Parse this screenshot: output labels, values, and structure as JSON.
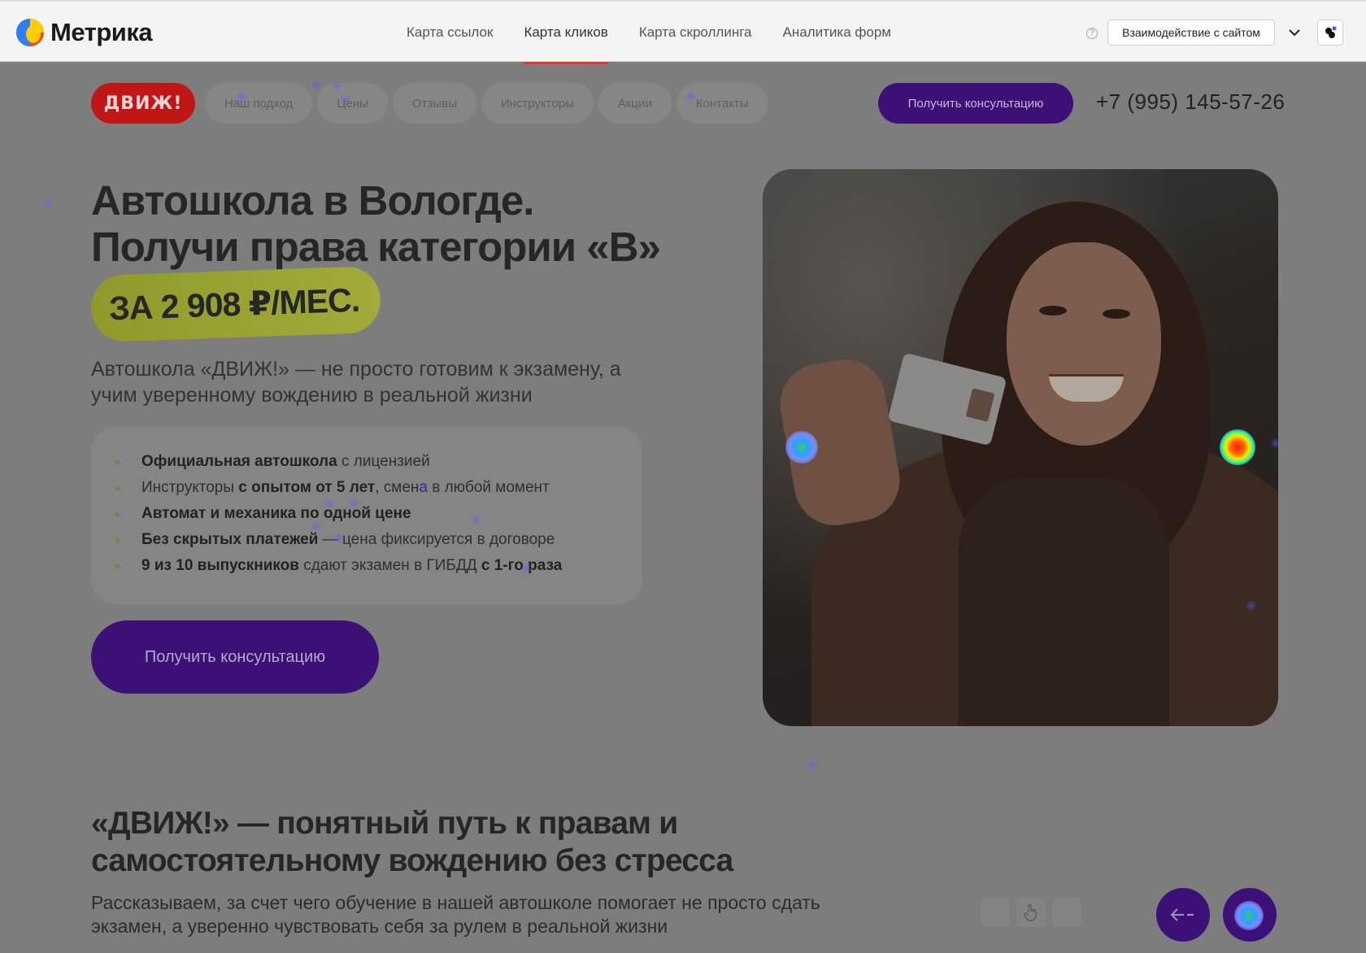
{
  "metrika": {
    "logo_text": "Метрика",
    "tabs": [
      {
        "label": "Карта ссылок",
        "active": false
      },
      {
        "label": "Карта кликов",
        "active": true
      },
      {
        "label": "Карта скроллинга",
        "active": false
      },
      {
        "label": "Аналитика форм",
        "active": false
      }
    ],
    "help_glyph": "?",
    "mode_select": "Взаимодействие с сайтом"
  },
  "site": {
    "logo_text": "ДВИЖ!",
    "nav": [
      "Наш подход",
      "Цены",
      "Отзывы",
      "Инструкторы",
      "Акции",
      "Контакты"
    ],
    "cta_top": "Получить консультацию",
    "phone": "+7 (995) 145-57-26"
  },
  "hero": {
    "title_line1": "Автошкола в Вологде.",
    "title_line2": "Получи права категории «В»",
    "price_badge": "ЗА 2 908 ₽/МЕС.",
    "subtitle": "Автошкола «ДВИЖ!» — не просто готовим к экзамену, а учим уверенному вождению в реальной жизни",
    "features": [
      {
        "bold1": "Официальная автошкола",
        "text1": " с лицензией",
        "bold2": "",
        "text2": ""
      },
      {
        "bold1": "",
        "text1": "Инструкторы ",
        "bold2": "с опытом от 5 лет",
        "text2": ", смена в любой момент"
      },
      {
        "bold1": "Автомат и механика по одной цене",
        "text1": "",
        "bold2": "",
        "text2": ""
      },
      {
        "bold1": "Без скрытых платежей",
        "text1": " — цена фиксируется в договоре",
        "bold2": "",
        "text2": ""
      },
      {
        "bold1": "9 из 10 выпускников",
        "text1": " сдают экзамен в ГИБДД ",
        "bold2": "с 1-го раза",
        "text2": ""
      }
    ],
    "cta": "Получить консультацию"
  },
  "section2": {
    "title_line1": "«ДВИЖ!» — понятный путь к правам и",
    "title_line2": "самостоятельному вождению без стресса",
    "subtitle": "Рассказываем, за счет чего обучение в нашей автошколе помогает не просто сдать экзамен, а уверенно чувствовать себя за рулем в реальной жизни"
  },
  "colors": {
    "accent_purple": "#3d1078",
    "brand_red": "#c01616",
    "metrika_active_underline": "#e7362f",
    "price_badge_green": "#a2ab3a"
  }
}
